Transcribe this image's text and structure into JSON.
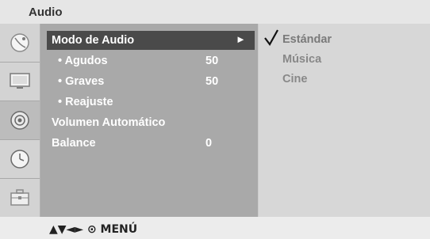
{
  "title": "Audio",
  "sidebar": {
    "items": [
      {
        "icon": "satellite-dish-icon"
      },
      {
        "icon": "monitor-icon"
      },
      {
        "icon": "speaker-icon"
      },
      {
        "icon": "clock-icon"
      },
      {
        "icon": "toolbox-icon"
      }
    ]
  },
  "menu": {
    "items": [
      {
        "label": "Modo de Audio",
        "arrow": "►"
      },
      {
        "label": "• Agudos",
        "value": "50"
      },
      {
        "label": "• Graves",
        "value": "50"
      },
      {
        "label": "• Reajuste"
      },
      {
        "label": "Volumen Automático"
      },
      {
        "label": "Balance",
        "value": "0"
      }
    ]
  },
  "options": {
    "check": "√",
    "items": [
      "Estándar",
      "Música",
      "Cine"
    ]
  },
  "footer": {
    "hint": "▲▼◄► ⊙ MENÚ"
  },
  "colors": {
    "menu_background": "#a9a9a9",
    "selected_row": "#4a4a4a",
    "option_text": "#888888"
  }
}
